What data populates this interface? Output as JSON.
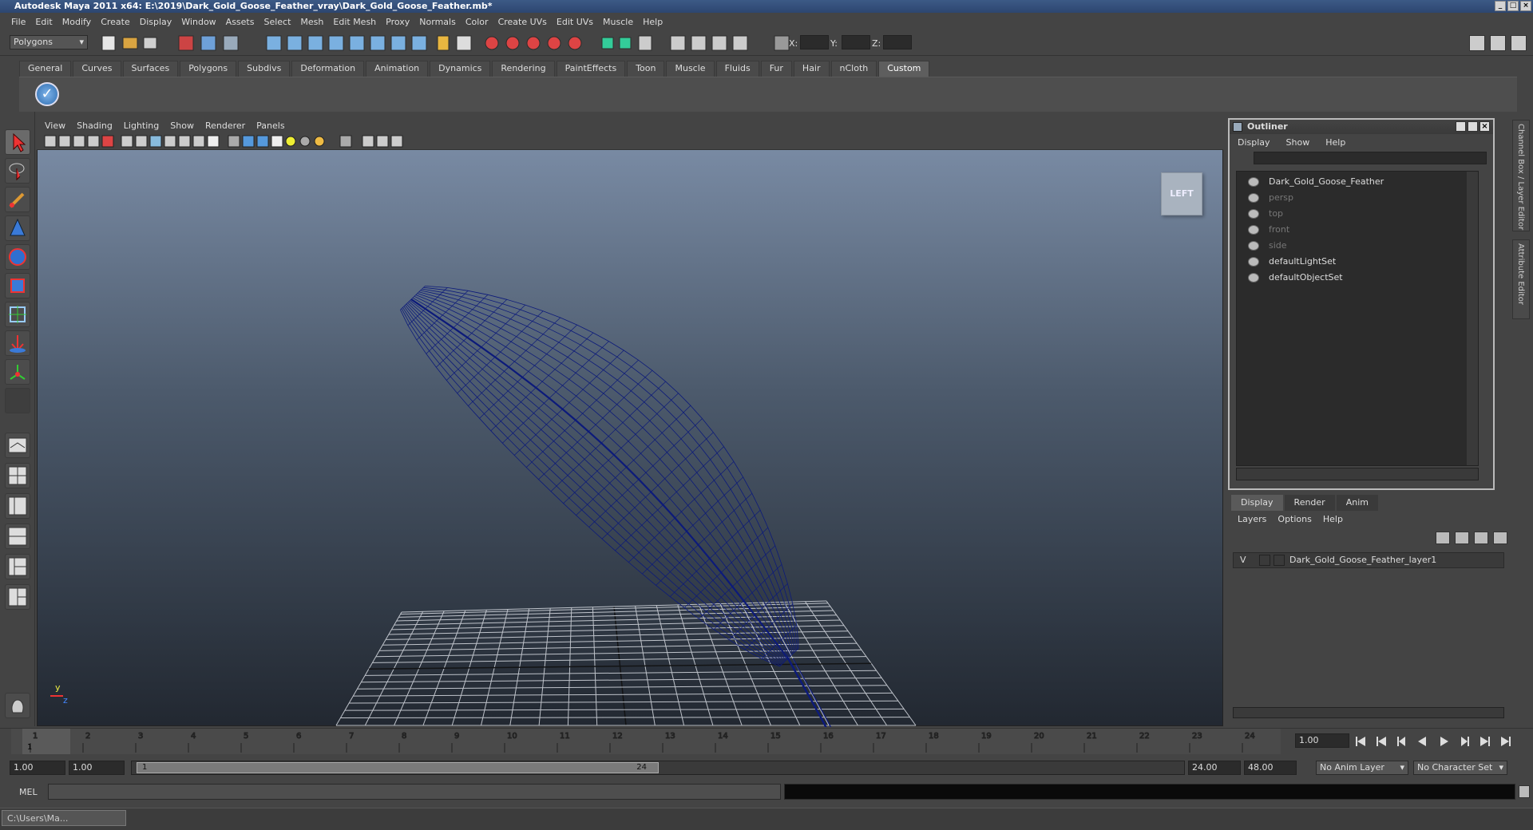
{
  "window": {
    "title": "Autodesk Maya 2011 x64: E:\\2019\\Dark_Gold_Goose_Feather_vray\\Dark_Gold_Goose_Feather.mb*"
  },
  "menubar": [
    "File",
    "Edit",
    "Modify",
    "Create",
    "Display",
    "Window",
    "Assets",
    "Select",
    "Mesh",
    "Edit Mesh",
    "Proxy",
    "Normals",
    "Color",
    "Create UVs",
    "Edit UVs",
    "Muscle",
    "Help"
  ],
  "statusline": {
    "mode": "Polygons",
    "x_label": "X:",
    "y_label": "Y:",
    "z_label": "Z:"
  },
  "shelf_tabs": [
    "General",
    "Curves",
    "Surfaces",
    "Polygons",
    "Subdivs",
    "Deformation",
    "Animation",
    "Dynamics",
    "Rendering",
    "PaintEffects",
    "Toon",
    "Muscle",
    "Fluids",
    "Fur",
    "Hair",
    "nCloth",
    "Custom"
  ],
  "shelf_active": "Custom",
  "viewport": {
    "menu": [
      "View",
      "Shading",
      "Lighting",
      "Show",
      "Renderer",
      "Panels"
    ],
    "viewcube_label": "LEFT",
    "axis_y": "y",
    "axis_z": "z"
  },
  "outliner": {
    "title": "Outliner",
    "menu": [
      "Display",
      "Show",
      "Help"
    ],
    "items": [
      {
        "label": "Dark_Gold_Goose_Feather",
        "dim": false
      },
      {
        "label": "persp",
        "dim": true
      },
      {
        "label": "top",
        "dim": true
      },
      {
        "label": "front",
        "dim": true
      },
      {
        "label": "side",
        "dim": true
      },
      {
        "label": "defaultLightSet",
        "dim": false
      },
      {
        "label": "defaultObjectSet",
        "dim": false
      }
    ]
  },
  "right_edge_tabs": {
    "channel": "Channel Box / Layer Editor",
    "attribute": "Attribute Editor"
  },
  "layers": {
    "tabs": [
      "Display",
      "Render",
      "Anim"
    ],
    "active_tab": "Display",
    "menu": [
      "Layers",
      "Options",
      "Help"
    ],
    "row": {
      "visibility": "V",
      "name": "Dark_Gold_Goose_Feather_layer1"
    }
  },
  "timeline": {
    "ticks": [
      "1",
      "2",
      "3",
      "4",
      "5",
      "6",
      "7",
      "8",
      "9",
      "10",
      "11",
      "12",
      "13",
      "14",
      "15",
      "16",
      "17",
      "18",
      "19",
      "20",
      "21",
      "22",
      "23",
      "24"
    ],
    "current_frame_marker": "1",
    "current_time": "1.00"
  },
  "range": {
    "start": "1.00",
    "playback_start": "1.00",
    "slider_start": "1",
    "slider_end": "24",
    "playback_end": "24.00",
    "end": "48.00",
    "anim_layer": "No Anim Layer",
    "character_set": "No Character Set"
  },
  "command": {
    "label": "MEL"
  },
  "taskbar": {
    "label": "C:\\Users\\Ma..."
  },
  "colors": {
    "mesh": "#0c1a7a",
    "grid": "#cfd3da",
    "accent": "#3c5a86"
  }
}
